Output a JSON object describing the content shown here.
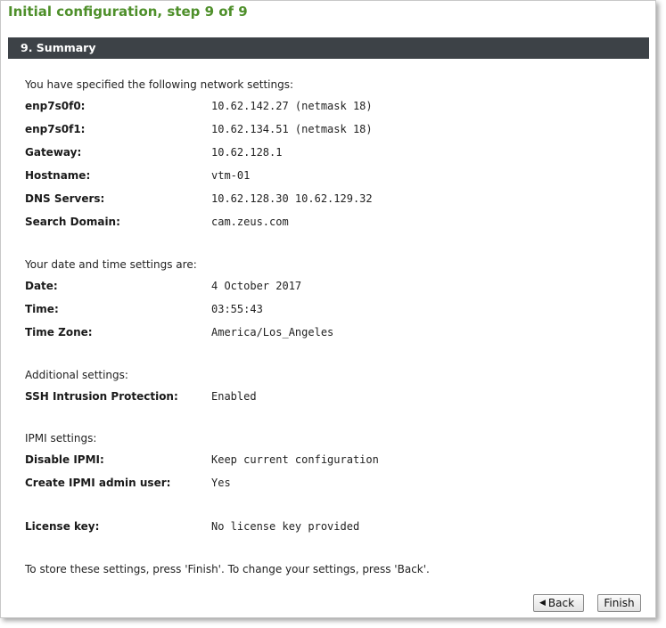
{
  "page": {
    "title": "Initial configuration, step 9 of 9",
    "section_title": "9. Summary"
  },
  "network": {
    "intro": "You have specified the following network settings:",
    "rows": [
      {
        "label": "enp7s0f0:",
        "value": "10.62.142.27 (netmask 18)"
      },
      {
        "label": "enp7s0f1:",
        "value": "10.62.134.51 (netmask 18)"
      },
      {
        "label": "Gateway:",
        "value": "10.62.128.1"
      },
      {
        "label": "Hostname:",
        "value": "vtm-01"
      },
      {
        "label": "DNS Servers:",
        "value": "10.62.128.30 10.62.129.32"
      },
      {
        "label": "Search Domain:",
        "value": "cam.zeus.com"
      }
    ]
  },
  "datetime": {
    "intro": "Your date and time settings are:",
    "rows": [
      {
        "label": "Date:",
        "value": "4 October 2017"
      },
      {
        "label": "Time:",
        "value": "03:55:43"
      },
      {
        "label": "Time Zone:",
        "value": "America/Los_Angeles"
      }
    ]
  },
  "additional": {
    "intro": "Additional settings:",
    "rows": [
      {
        "label": "SSH Intrusion Protection:",
        "value": "Enabled"
      }
    ]
  },
  "ipmi": {
    "intro": "IPMI settings:",
    "rows": [
      {
        "label": "Disable IPMI:",
        "value": "Keep current configuration"
      },
      {
        "label": "Create IPMI admin user:",
        "value": "Yes"
      }
    ]
  },
  "license": {
    "label": "License key:",
    "value": "No license key provided"
  },
  "footer": {
    "note": "To store these settings, press 'Finish'. To change your settings, press 'Back'.",
    "back_label": "Back",
    "finish_label": "Finish"
  }
}
